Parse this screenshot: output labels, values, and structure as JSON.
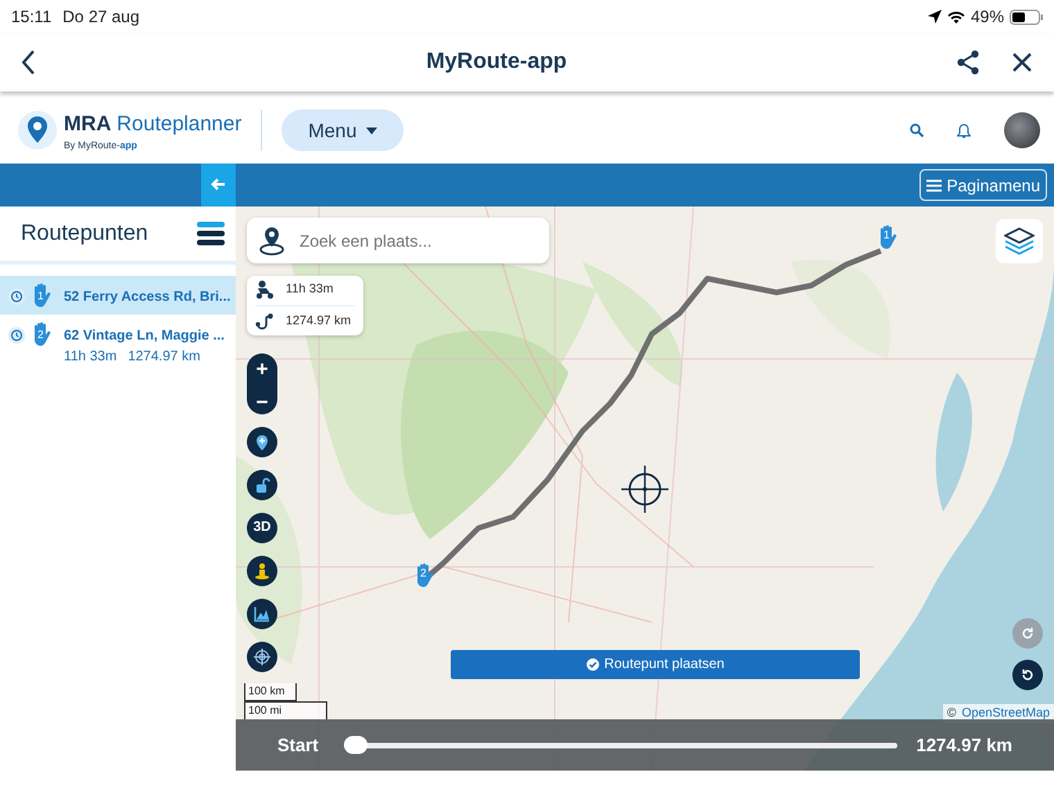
{
  "status_bar": {
    "time": "15:11",
    "date": "Do 27 aug",
    "battery": "49%"
  },
  "nav_bar": {
    "title": "MyRoute-app"
  },
  "header": {
    "brand_bold": "MRA",
    "brand": "Routeplanner",
    "byline": "By MyRoute-**app**",
    "menu_button": "Menu"
  },
  "toolbar": {
    "page_menu": "Paginamenu"
  },
  "sidebar": {
    "title": "Routepunten",
    "items": [
      {
        "number": "1",
        "name": "52 Ferry Access Rd, Bri...",
        "selected": true
      },
      {
        "number": "2",
        "name": "62 Vintage Ln, Maggie ...",
        "selected": false,
        "duration": "11h 33m",
        "distance": "1274.97 km"
      }
    ]
  },
  "map": {
    "search": {
      "placeholder": "Zoek een plaats..."
    },
    "summary": {
      "duration": "11h 33m",
      "distance": "1274.97 km"
    },
    "controls": [
      {
        "kind": "zoom",
        "plus": "+",
        "minus": "−"
      },
      {
        "kind": "pin"
      },
      {
        "kind": "lock"
      },
      {
        "kind": "text",
        "label": "3D"
      },
      {
        "kind": "person"
      },
      {
        "kind": "chart"
      },
      {
        "kind": "target"
      }
    ],
    "scale": [
      "100 km",
      "100 mi"
    ],
    "markers": [
      {
        "number": "1"
      },
      {
        "number": "2"
      }
    ],
    "action_button": "Routepunt plaatsen",
    "attribution": {
      "symbol": "©",
      "link": "OpenStreetMap"
    },
    "route_slider": {
      "start_label": "Start",
      "level": 0,
      "end_label": "1274.97 km"
    }
  }
}
